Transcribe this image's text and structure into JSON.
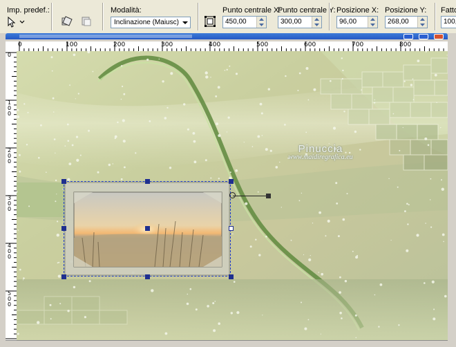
{
  "toolbar": {
    "preset_label": "Imp. predef.:",
    "mode_label": "Modalità:",
    "mode_value": "Inclinazione (Maiusc)",
    "center_x_label": "Punto centrale X:",
    "center_x_value": "450,00",
    "center_y_label": "Punto centrale Y:",
    "center_y_value": "300,00",
    "pos_x_label": "Posizione X:",
    "pos_x_value": "96,00",
    "pos_y_label": "Posizione Y:",
    "pos_y_value": "268,00",
    "scale_label": "Fatto",
    "scale_value": "100,"
  },
  "ruler": {
    "h_labels": [
      "0",
      "100",
      "200",
      "300",
      "400",
      "500",
      "600",
      "700",
      "800"
    ],
    "v_labels": [
      "0",
      "100",
      "200",
      "300",
      "400",
      "500"
    ]
  },
  "canvas": {
    "watermark_name": "Pinuccia",
    "watermark_url": "www.maidiregrafica.eu"
  },
  "colors": {
    "toolbar_bg": "#ece9d8",
    "title_bar": "#2458c5",
    "selection": "#1e3ad0",
    "background_green": "#b9d69a"
  }
}
